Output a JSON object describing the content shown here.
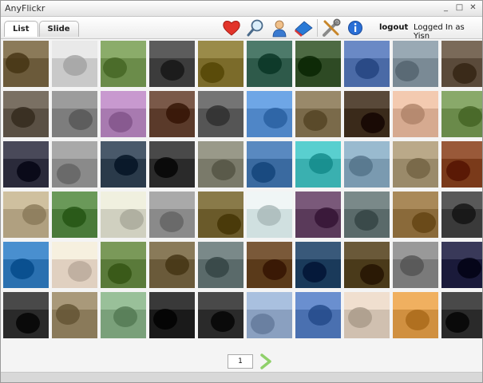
{
  "app": {
    "title": "AnyFlickr"
  },
  "window_controls": {
    "minimize": "_",
    "maximize": "□",
    "close": "✕"
  },
  "tabs": [
    {
      "label": "List",
      "active": true
    },
    {
      "label": "Slide",
      "active": false
    }
  ],
  "toolbar": {
    "icons": [
      "heart-icon",
      "magnifier-icon",
      "user-icon",
      "upload-icon",
      "tools-icon",
      "info-icon"
    ],
    "logout_label": "logout",
    "logged_in_text": "Logged In as Yisn"
  },
  "pagination": {
    "current_page": "1"
  },
  "colors": {
    "accent_green": "#8fd06a",
    "info_blue": "#2a6fd6",
    "heart_red": "#e2342a"
  },
  "photos": [
    [
      "#6b5a3a",
      "#c9c9c9",
      "#6b8c4a",
      "#3c3c3c",
      "#7b6b2a",
      "#2e5a4a",
      "#2e4a24",
      "#4a6aa6",
      "#7a8a95",
      "#5a4a3a"
    ],
    [
      "#5a5044",
      "#7d7d7d",
      "#a87ab0",
      "#5a3a2a",
      "#555555",
      "#4f86c7",
      "#7a6a4a",
      "#3a2a1a",
      "#d6aa90",
      "#6a8a4a"
    ],
    [
      "#2a2a3a",
      "#8a8a8a",
      "#2a3a4a",
      "#2a2a2a",
      "#7a7a6a",
      "#3a6aa0",
      "#3ab0b0",
      "#7a9ab0",
      "#9a8a6a",
      "#7a3a1a"
    ],
    [
      "#b0a080",
      "#4a7a3a",
      "#d0d0c0",
      "#8a8a8a",
      "#6a5a2a",
      "#d0e0e0",
      "#5a3a5a",
      "#5a6a6a",
      "#8a6a3a",
      "#3a3a3a"
    ],
    [
      "#2a70b0",
      "#e0d0c0",
      "#5a7a3a",
      "#6a5a3a",
      "#5a6a6a",
      "#5a3a1a",
      "#1a3a5a",
      "#4a3a1a",
      "#7a7a7a",
      "#1a1a3a"
    ],
    [
      "#2a2a2a",
      "#8a7a5a",
      "#7aa07a",
      "#1a1a1a",
      "#2a2a2a",
      "#8aa0c0",
      "#4a70b0",
      "#d0c0b0",
      "#d09040",
      "#2a2a2a"
    ]
  ]
}
